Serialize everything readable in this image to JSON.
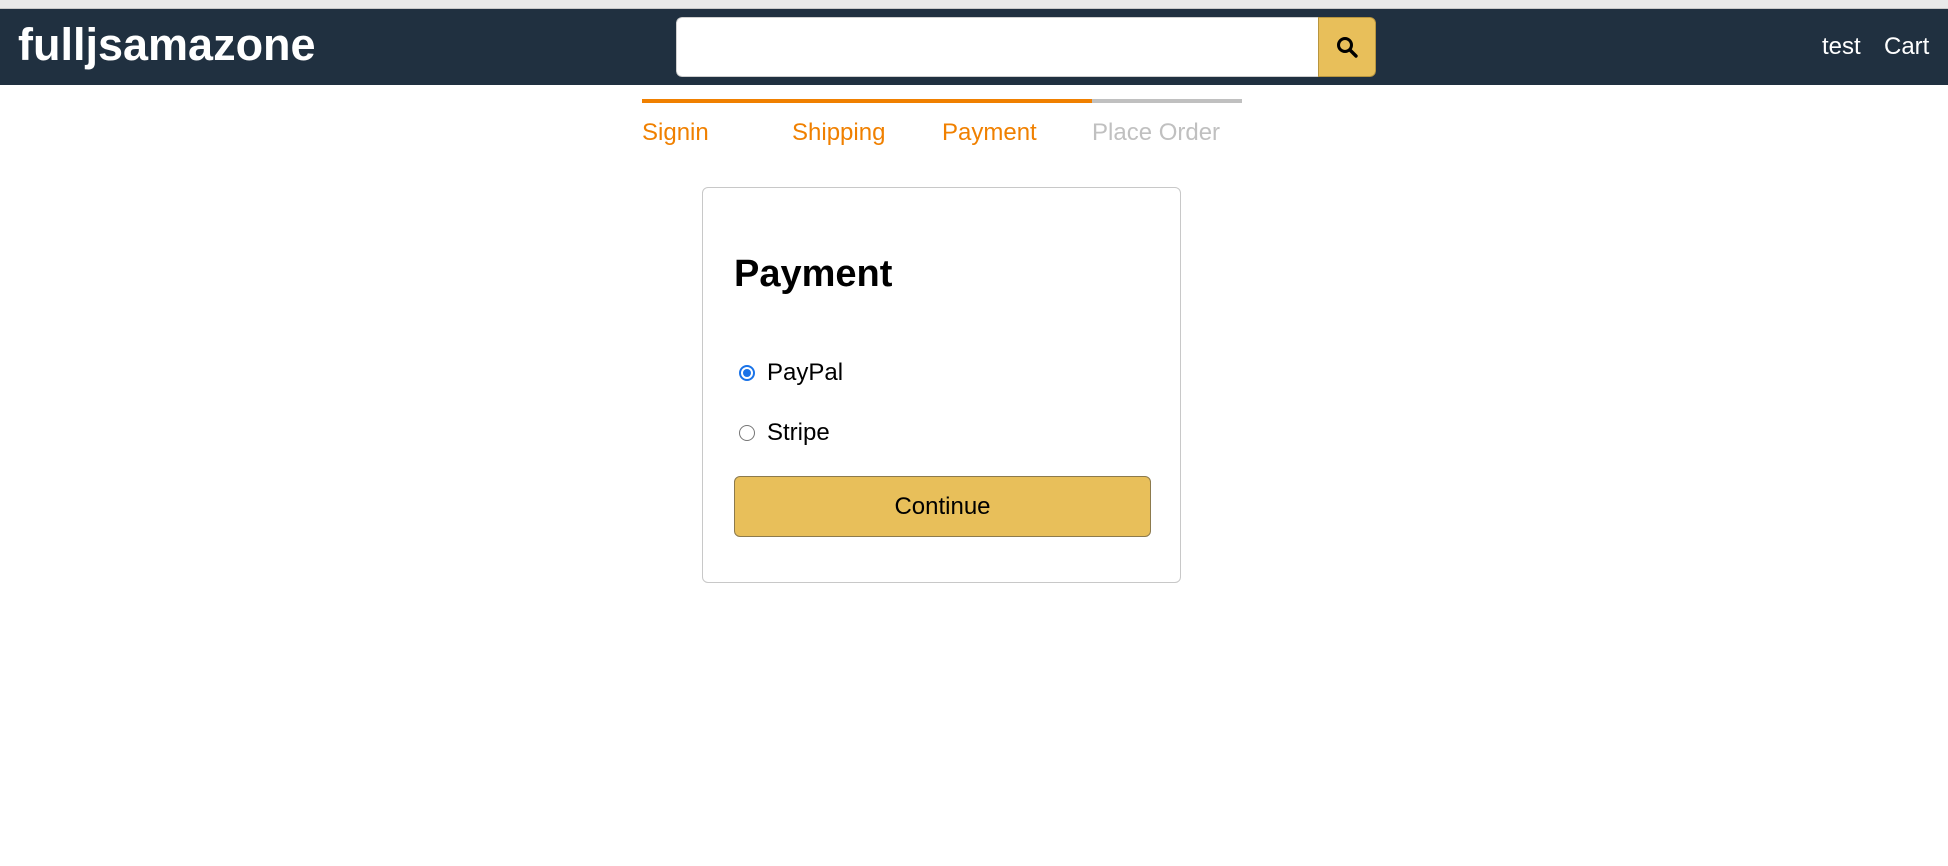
{
  "header": {
    "brand": "fulljsamazone",
    "search": {
      "value": "",
      "placeholder": ""
    },
    "search_icon": "search-icon",
    "user_link": "test",
    "cart_link": "Cart"
  },
  "checkout_steps": [
    {
      "label": "Signin",
      "active": true
    },
    {
      "label": "Shipping",
      "active": true
    },
    {
      "label": "Payment",
      "active": true
    },
    {
      "label": "Place Order",
      "active": false
    }
  ],
  "payment_form": {
    "title": "Payment",
    "options": [
      {
        "label": "PayPal",
        "checked": true
      },
      {
        "label": "Stripe",
        "checked": false
      }
    ],
    "continue_label": "Continue"
  },
  "colors": {
    "header_bg": "#203040",
    "accent_active_step": "#f08000",
    "inactive_step": "#c0c0c0",
    "button_bg": "#e8bf5a",
    "radio_selected": "#1a73e8"
  }
}
